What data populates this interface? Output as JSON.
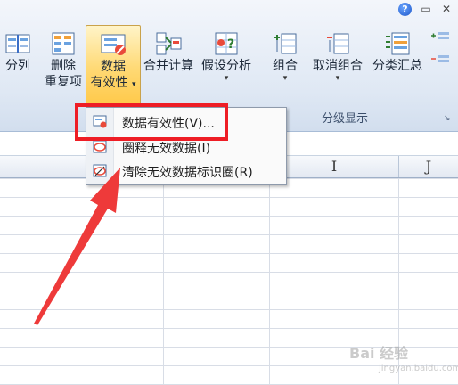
{
  "ribbon": {
    "buttons": {
      "text_to_columns": "分列",
      "remove_dup_1": "删除",
      "remove_dup_2": "重复项",
      "data_valid_1": "数据",
      "data_valid_2": "有效性",
      "consolidate": "合并计算",
      "what_if": "假设分析",
      "group": "组合",
      "ungroup": "取消组合",
      "subtotal": "分类汇总"
    },
    "outline_group_label": "分级显示"
  },
  "menu": {
    "items": [
      {
        "label": "数据有效性(V)...",
        "icon": "data-validation-icon"
      },
      {
        "label": "圈释无效数据(I)",
        "icon": "circle-invalid-icon"
      },
      {
        "label": "清除无效数据标识圈(R)",
        "icon": "clear-circles-icon"
      }
    ]
  },
  "columns": {
    "i": "I",
    "j": "J"
  },
  "watermark": {
    "main": "Bai 经验",
    "sub": "jingyan.baidu.com"
  },
  "colors": {
    "highlight": "#ee1d25",
    "accent": "#ffd974"
  }
}
